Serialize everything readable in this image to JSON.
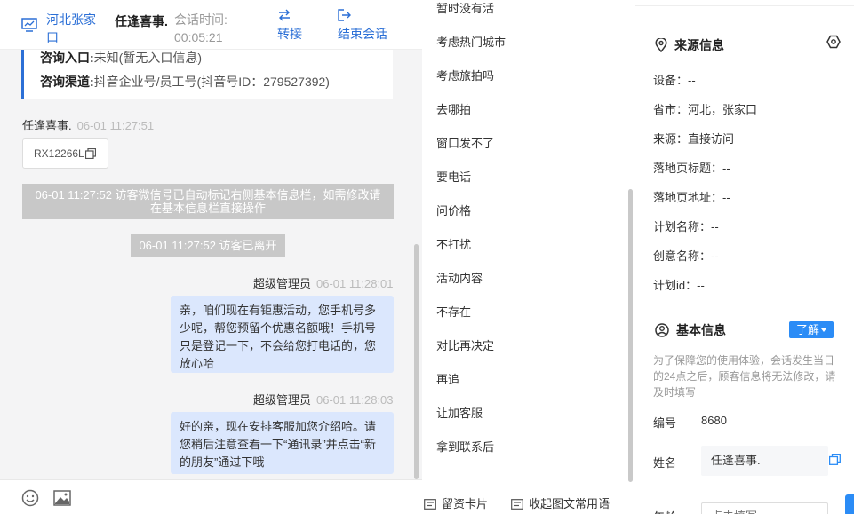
{
  "header": {
    "location": "河北张家口",
    "visitor_name": "任逢喜事.",
    "session_time_label": "会话时间:",
    "session_time": "00:05:21",
    "transfer_label": "转接",
    "end_label": "结束会话"
  },
  "entry": {
    "entry_label": "咨询入口:",
    "entry_value": "未知(暂无入口信息)",
    "channel_label": "咨询渠道:",
    "channel_value": "抖音企业号/员工号(抖音号ID：279527392)"
  },
  "messages": {
    "visitor_name": "任逢喜事.",
    "visitor_time": "06-01 11:27:51",
    "code_text": "RX12266L",
    "notice1": "06-01 11:27:52 访客微信号已自动标记右侧基本信息栏，如需修改请在基本信息栏直接操作",
    "notice2": "06-01 11:27:52 访客已离开",
    "admin1_name": "超级管理员",
    "admin1_time": "06-01 11:28:01",
    "admin1_text": "亲，咱们现在有钜惠活动，您手机号多少呢，帮您预留个优惠名额哦！手机号只是登记一下，不会给您打电话的，您放心哈",
    "admin2_name": "超级管理员",
    "admin2_time": "06-01 11:28:03",
    "admin2_text": "好的亲，现在安排客服加您介绍哈。请您稍后注意查看一下“通讯录”并点击“新的朋友”通过下哦"
  },
  "phrases": {
    "items": [
      "暂时没有活",
      "考虑热门城市",
      "考虑旅拍吗",
      "去哪拍",
      "窗口发不了",
      "要电话",
      "问价格",
      "不打扰",
      "活动内容",
      "不存在",
      "对比再决定",
      "再追",
      "让加客服",
      "拿到联系后"
    ],
    "footer_card": "留资卡片",
    "footer_collapse": "收起图文常用语"
  },
  "info": {
    "source_title": "来源信息",
    "source_rows": [
      "设备：--",
      "省市：河北，张家口",
      "来源：直接访问",
      "落地页标题：--",
      "落地页地址：--",
      "计划名称：--",
      "创意名称：--",
      "计划id：--"
    ],
    "basic_title": "基本信息",
    "learn_label": "了解",
    "tip": "为了保障您的使用体验，会话发生当日的24点之后，顾客信息将无法修改，请及时填写",
    "id_label": "编号",
    "id_value": "8680",
    "name_label": "姓名",
    "name_value": "任逢喜事.",
    "age_label": "年龄",
    "age_placeholder": "点击填写"
  },
  "colors": {
    "accent": "#2b6fd6",
    "bubble": "#dbe7fd",
    "notice": "#c8c8c8"
  }
}
